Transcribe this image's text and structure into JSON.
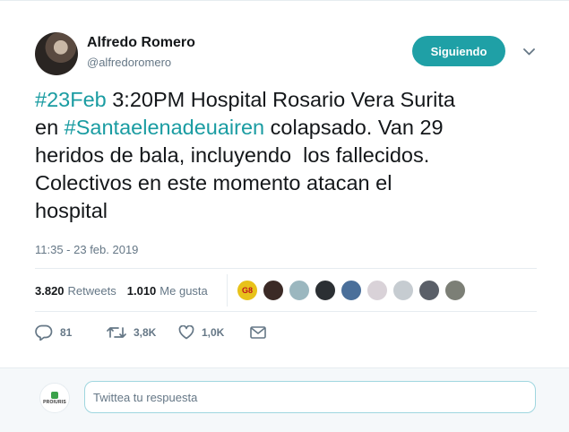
{
  "author": {
    "name": "Alfredo Romero",
    "handle": "@alfredoromero"
  },
  "follow_button": {
    "label": "Siguiendo"
  },
  "tweet": {
    "segments": [
      {
        "text": "#23Feb",
        "hashtag": true
      },
      {
        "text": " 3:20PM Hospital Rosario Vera Surita\nen ",
        "hashtag": false
      },
      {
        "text": "#Santaelenadeuairen",
        "hashtag": true
      },
      {
        "text": " colapsado. Van 29\nheridos de bala, incluyendo  los fallecidos.\nColectivos en este momento atacan el\nhospital",
        "hashtag": false
      }
    ],
    "timestamp": "11:35 - 23 feb. 2019"
  },
  "stats": {
    "retweets_count": "3.820",
    "retweets_label": "Retweets",
    "likes_count": "1.010",
    "likes_label": "Me gusta"
  },
  "liker_avatars": [
    {
      "name": "liker-avatar-1",
      "color": "#e8c21a",
      "text": "G8"
    },
    {
      "name": "liker-avatar-2",
      "color": "#3b2a26"
    },
    {
      "name": "liker-avatar-3",
      "color": "#9bb7bf"
    },
    {
      "name": "liker-avatar-4",
      "color": "#2b2f33"
    },
    {
      "name": "liker-avatar-5",
      "color": "#4a6f9a"
    },
    {
      "name": "liker-avatar-6",
      "color": "#d9d2d8"
    },
    {
      "name": "liker-avatar-7",
      "color": "#c6ccd1"
    },
    {
      "name": "liker-avatar-8",
      "color": "#5a5f68"
    },
    {
      "name": "liker-avatar-9",
      "color": "#7c7f76"
    }
  ],
  "actions": {
    "reply_count": "81",
    "retweet_count": "3,8K",
    "like_count": "1,0K"
  },
  "reply": {
    "placeholder": "Twittea tu respuesta",
    "avatar_text": "PROIURIS"
  },
  "colors": {
    "accent": "#1fa0a6",
    "hashtag": "#1a9ca2",
    "muted": "#657786"
  }
}
